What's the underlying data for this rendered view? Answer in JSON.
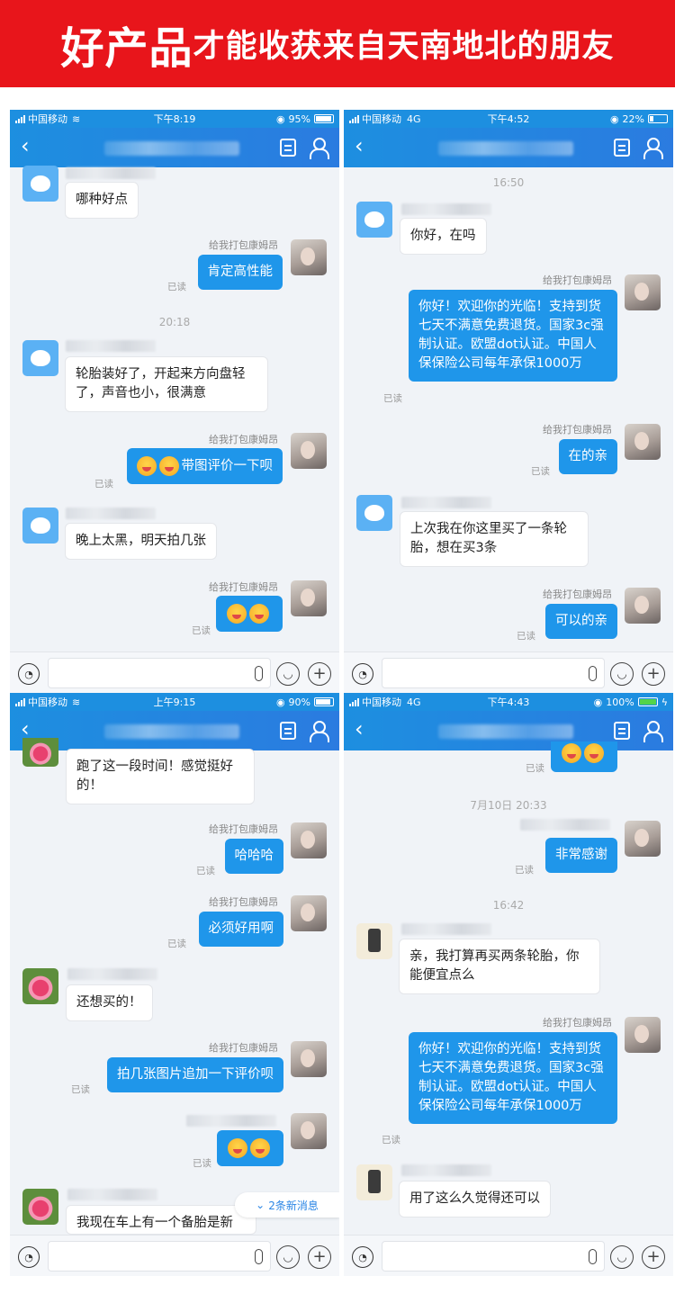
{
  "banner": {
    "big": "好产品",
    "small": "才能收获来自天南地北的朋友"
  },
  "common": {
    "agent_name": "给我打包康姆昂",
    "read": "已读",
    "back_glyph": "‹"
  },
  "panels": [
    {
      "status": {
        "carrier": "中国移动",
        "network": "",
        "time": "下午8:19",
        "battery": "95%"
      },
      "stamps": [
        "20:18"
      ],
      "messages": [
        "哪种好点",
        "肯定高性能",
        "轮胎装好了，开起来方向盘轻了，声音也小，很满意",
        "带图评价一下呗",
        "晚上太黑，明天拍几张",
        ""
      ]
    },
    {
      "status": {
        "carrier": "中国移动",
        "network": "4G",
        "time": "下午4:52",
        "battery": "22%"
      },
      "stamps": [
        "16:50"
      ],
      "messages": [
        "你好，在吗",
        "你好！欢迎你的光临！支持到货七天不满意免费退货。国家3c强制认证。欧盟dot认证。中国人保保险公司每年承保1000万",
        "在的亲",
        "上次我在你这里买了一条轮胎，想在买3条",
        "可以的亲"
      ]
    },
    {
      "status": {
        "carrier": "中国移动",
        "network": "",
        "time": "上午9:15",
        "battery": "90%"
      },
      "messages": [
        "跑了这一段时间！感觉挺好的！",
        "哈哈哈",
        "必须好用啊",
        "还想买的！",
        "拍几张图片追加一下评价呗",
        "",
        "我现在车上有一个备胎是新"
      ],
      "new_messages": "2条新消息"
    },
    {
      "status": {
        "carrier": "中国移动",
        "network": "4G",
        "time": "下午4:43",
        "battery": "100%"
      },
      "stamps": [
        "7月10日 20:33",
        "16:42"
      ],
      "messages": [
        "非常感谢",
        "亲，我打算再买两条轮胎，你能便宜点么",
        "你好！欢迎你的光临！支持到货七天不满意免费退货。国家3c强制认证。欧盟dot认证。中国人保保险公司每年承保1000万",
        "用了这么久觉得还可以"
      ]
    }
  ]
}
